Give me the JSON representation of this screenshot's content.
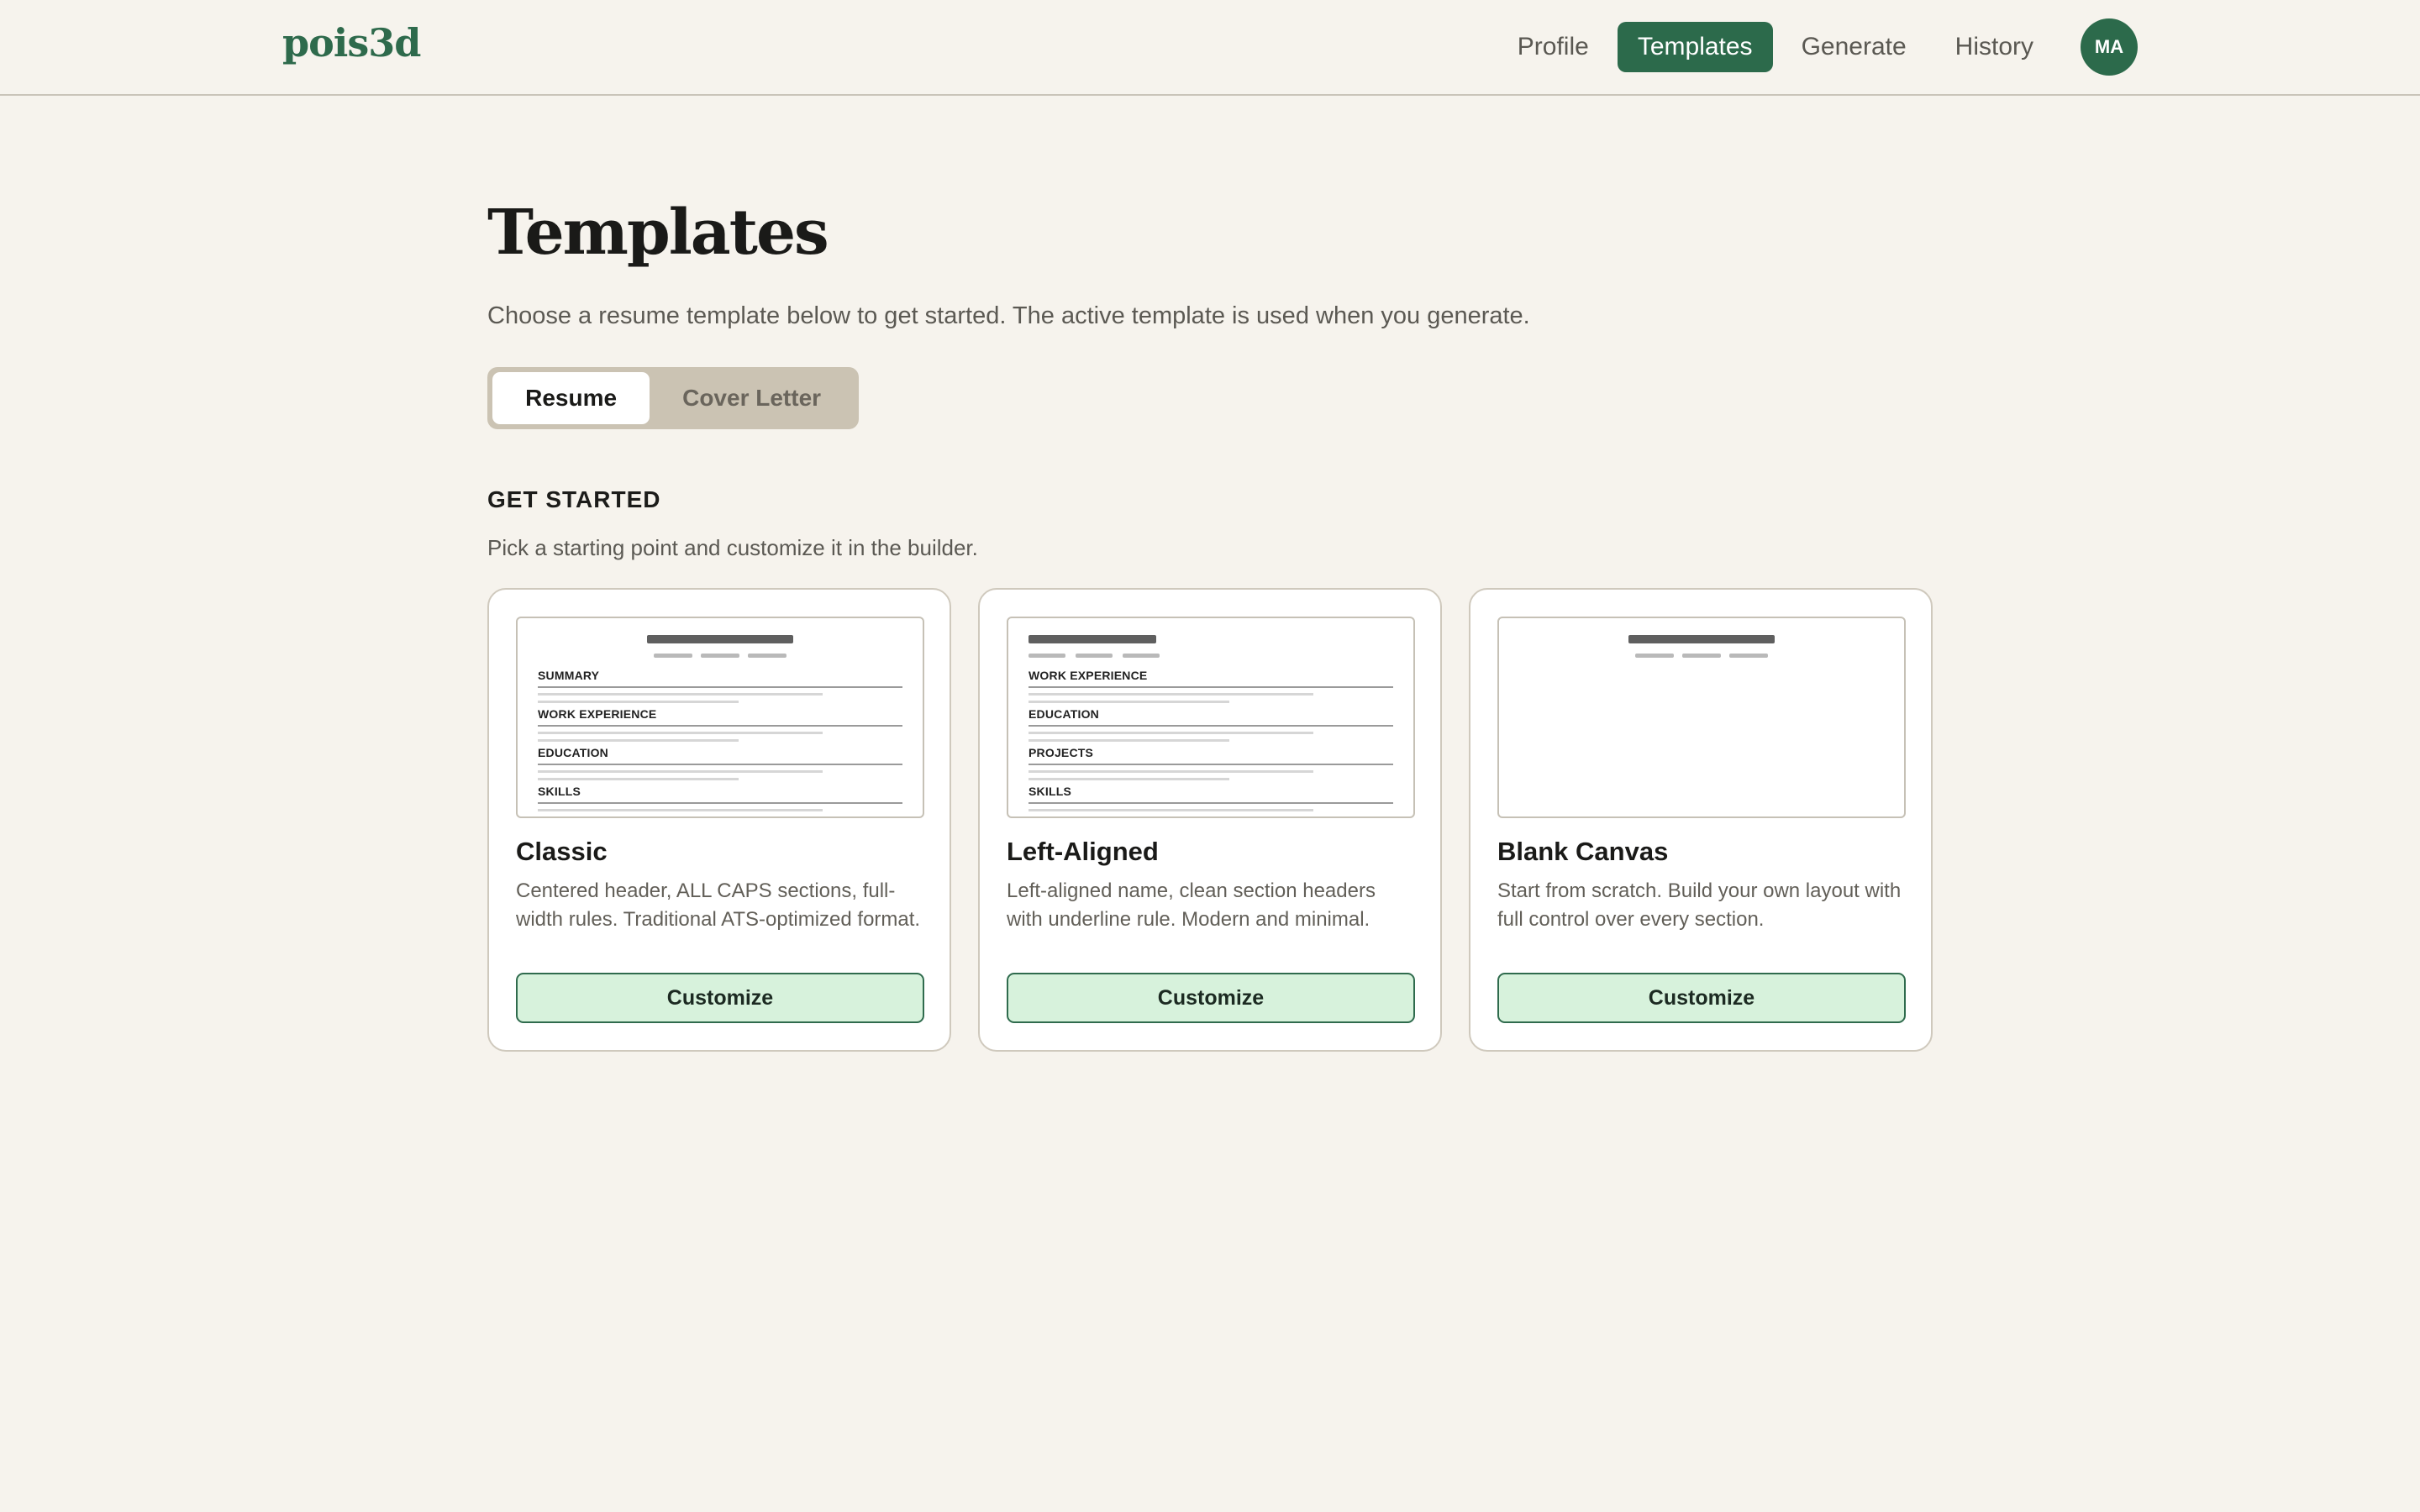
{
  "brand": {
    "logo": "pois3d",
    "accent": "#2c6a4b"
  },
  "nav": {
    "items": [
      {
        "label": "Profile",
        "active": false
      },
      {
        "label": "Templates",
        "active": true
      },
      {
        "label": "Generate",
        "active": false
      },
      {
        "label": "History",
        "active": false
      }
    ],
    "avatar_initials": "MA"
  },
  "page": {
    "title": "Templates",
    "subtitle": "Choose a resume template below to get started. The active template is used when you generate."
  },
  "toggle": {
    "options": [
      "Resume",
      "Cover Letter"
    ],
    "selected": "Resume"
  },
  "get_started": {
    "title": "GET STARTED",
    "subtitle": "Pick a starting point and customize it in the builder."
  },
  "cards": [
    {
      "title": "Classic",
      "description": "Centered header, ALL CAPS sections, full-width rules. Traditional ATS-optimized format.",
      "button": "Customize",
      "preview_sections": [
        "SUMMARY",
        "WORK EXPERIENCE",
        "EDUCATION",
        "SKILLS"
      ]
    },
    {
      "title": "Left-Aligned",
      "description": "Left-aligned name, clean section headers with underline rule. Modern and minimal.",
      "button": "Customize",
      "preview_sections": [
        "WORK EXPERIENCE",
        "EDUCATION",
        "PROJECTS",
        "SKILLS"
      ]
    },
    {
      "title": "Blank Canvas",
      "description": "Start from scratch. Build your own layout with full control over every section.",
      "button": "Customize",
      "preview_sections": []
    }
  ]
}
